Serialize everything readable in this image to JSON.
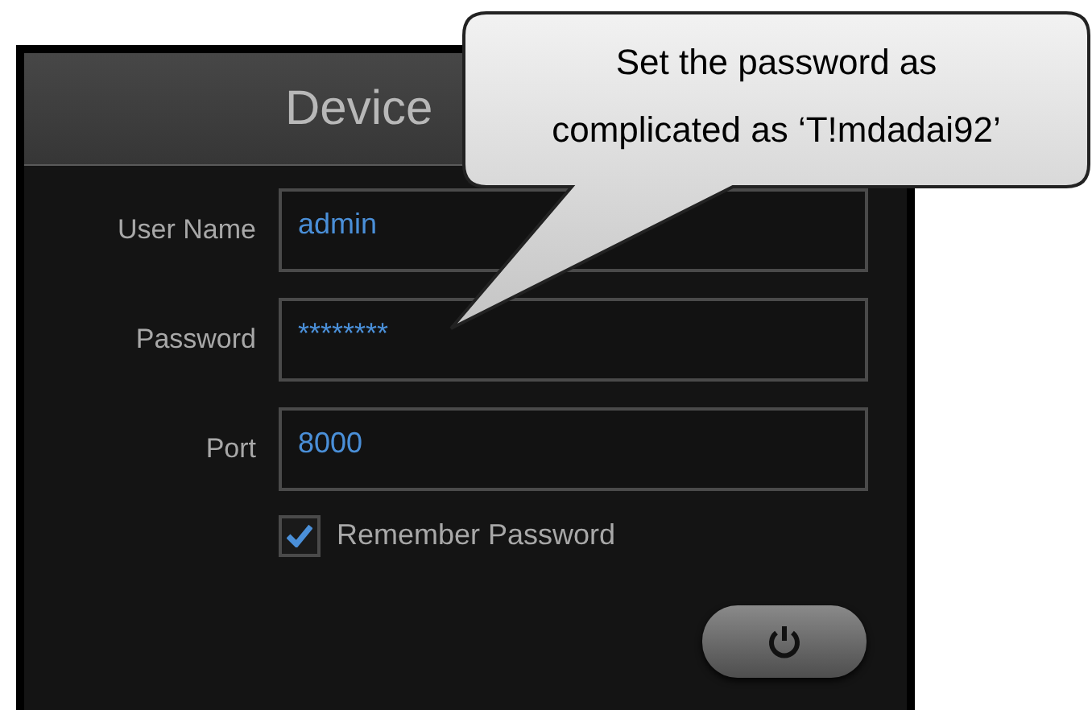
{
  "dialog": {
    "title": "Device"
  },
  "fields": [
    {
      "label": "User Name",
      "value": "admin"
    },
    {
      "label": "Password",
      "value": "********"
    },
    {
      "label": "Port",
      "value": "8000"
    }
  ],
  "remember": {
    "label": "Remember Password",
    "checked": true
  },
  "callout": {
    "lines": [
      "Set the password as",
      "complicated as ‘T!mdadai92’"
    ]
  }
}
